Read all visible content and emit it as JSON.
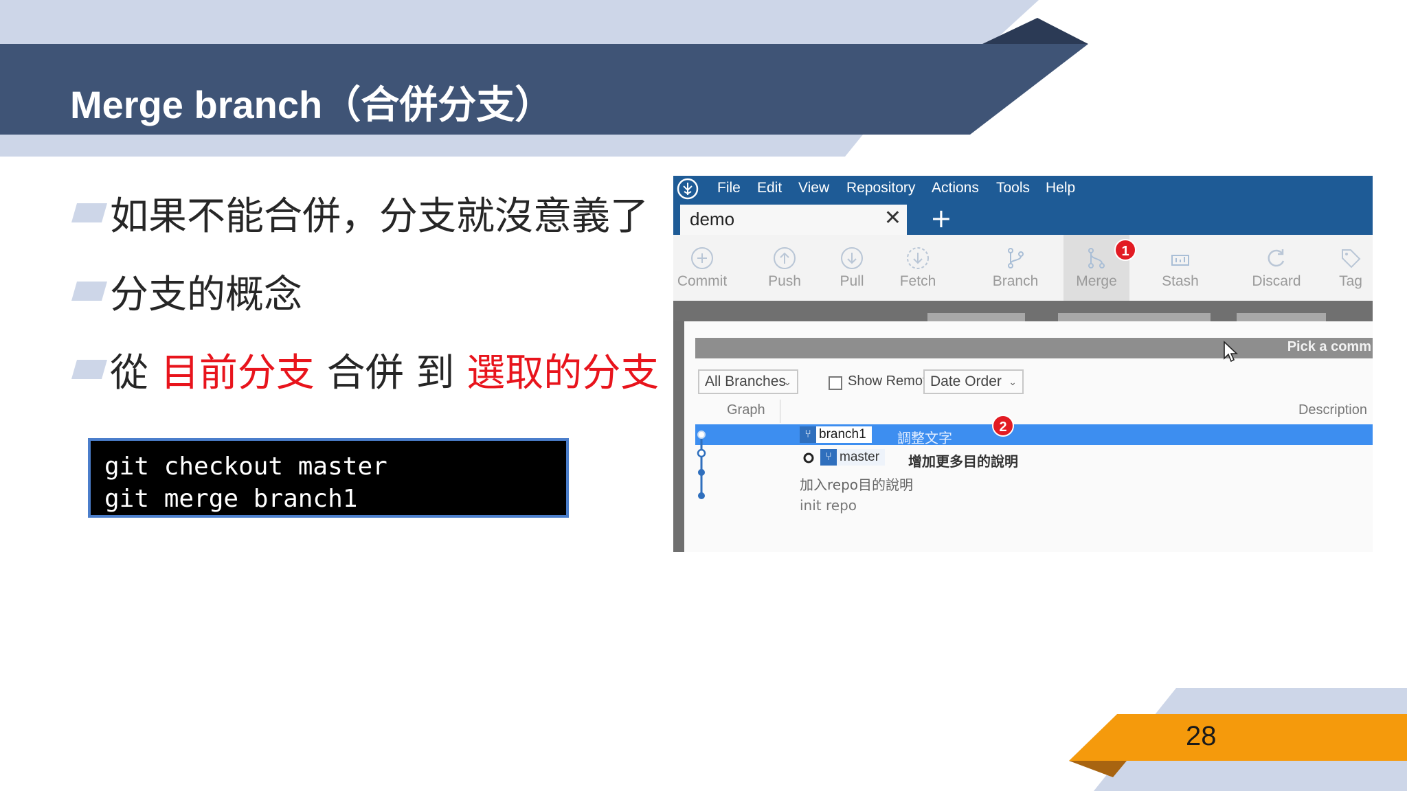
{
  "slide": {
    "title": "Merge branch（合併分支）",
    "bullets": [
      {
        "segments": [
          {
            "text": "如果不能合併，分支就沒意義了",
            "color": "#262626"
          }
        ]
      },
      {
        "segments": [
          {
            "text": "分支的概念",
            "color": "#262626"
          }
        ]
      },
      {
        "segments": [
          {
            "text": "從 ",
            "color": "#262626"
          },
          {
            "text": "目前分支",
            "color": "#e8141c"
          },
          {
            "text": " 合併 到 ",
            "color": "#262626"
          },
          {
            "text": "選取的分支",
            "color": "#e8141c"
          }
        ]
      }
    ],
    "code": [
      "git checkout master",
      "git merge branch1"
    ],
    "page_number": "28"
  },
  "app": {
    "menu": [
      "File",
      "Edit",
      "View",
      "Repository",
      "Actions",
      "Tools",
      "Help"
    ],
    "tab": {
      "label": "demo",
      "close": "✕",
      "add": "+"
    },
    "toolbar": [
      {
        "label": "Commit",
        "icon": "plus-circle-icon"
      },
      {
        "label": "Push",
        "icon": "arrow-up-circle-icon"
      },
      {
        "label": "Pull",
        "icon": "arrow-down-circle-icon"
      },
      {
        "label": "Fetch",
        "icon": "arrow-down-dashed-circle-icon"
      },
      {
        "label": "Branch",
        "icon": "branch-icon"
      },
      {
        "label": "Merge",
        "icon": "merge-icon"
      },
      {
        "label": "Stash",
        "icon": "stash-icon"
      },
      {
        "label": "Discard",
        "icon": "discard-icon"
      },
      {
        "label": "Tag",
        "icon": "tag-icon"
      }
    ],
    "ghost_filters": [
      "All Branches",
      "Show Remote Branches",
      "Date Order"
    ],
    "pick_text": "Pick a comm",
    "filters": {
      "branches": "All Branches",
      "show_remote": "Show Remote Branches",
      "order": "Date Order"
    },
    "columns": {
      "graph": "Graph",
      "description": "Description"
    },
    "commits": [
      {
        "branch": "branch1",
        "message": "調整文字",
        "selected": true
      },
      {
        "branch": "master",
        "message": "增加更多目的說明",
        "selected": false
      },
      {
        "branch": "",
        "message": "加入repo目的說明",
        "selected": false
      },
      {
        "branch": "",
        "message": "init repo",
        "selected": false
      }
    ],
    "badges": [
      "1",
      "2"
    ]
  },
  "colors": {
    "banner_dark": "#3f5476",
    "banner_light": "#cdd6e8",
    "accent_red": "#e8141c",
    "accent_orange": "#f59a0c",
    "app_blue": "#1e5b96",
    "selection_blue": "#3d8ef0"
  }
}
